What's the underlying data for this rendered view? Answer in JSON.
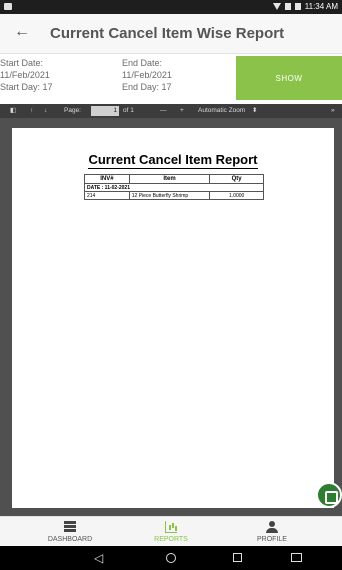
{
  "status_bar": {
    "time": "11:34 AM"
  },
  "app_bar": {
    "back_icon": "arrow-left-icon",
    "title": "Current Cancel Item Wise Report"
  },
  "filters": {
    "start_date_label": "Start Date:",
    "start_date_value": "11/Feb/2021",
    "start_day": "Start Day: 17",
    "end_date_label": "End Date:",
    "end_date_value": "11/Feb/2021",
    "end_day": "End Day: 17",
    "show_button": "SHOW"
  },
  "pdf_toolbar": {
    "page_label": "Page:",
    "page_value": "1",
    "page_total": "of 1",
    "zoom_minus": "—",
    "zoom_plus": "+",
    "zoom_value": "Automatic Zoom",
    "more": "»"
  },
  "report": {
    "title": "Current Cancel Item Report",
    "columns": [
      "INV#",
      "Item",
      "Qty"
    ],
    "date_row": "DATE : 11-02-2021",
    "rows": [
      {
        "inv": "214",
        "item": "12 Piece Butterfly Shrimp",
        "qty": "1.0000"
      }
    ]
  },
  "bottom_nav": {
    "items": [
      {
        "label": "DASHBOARD",
        "icon": "dashboard-icon"
      },
      {
        "label": "REPORTS",
        "icon": "bar-chart-icon"
      },
      {
        "label": "PROFILE",
        "icon": "person-icon"
      }
    ]
  },
  "colors": {
    "accent": "#8bc34a",
    "fab": "#2e7d32",
    "toolbar": "#3c3c3c"
  }
}
